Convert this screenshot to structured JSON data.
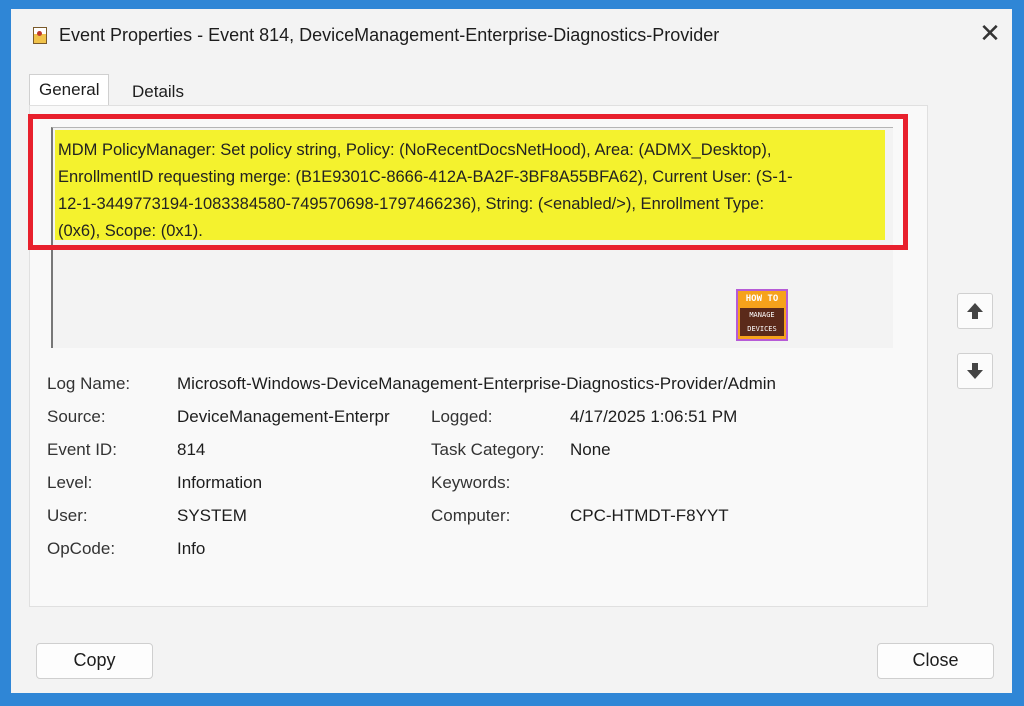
{
  "window": {
    "title": "Event Properties - Event 814, DeviceManagement-Enterprise-Diagnostics-Provider",
    "close_glyph": "✕"
  },
  "tabs": [
    {
      "label": "General"
    },
    {
      "label": "Details"
    }
  ],
  "message": {
    "lines": [
      "MDM PolicyManager: Set policy string, Policy: (NoRecentDocsNetHood), Area: (ADMX_Desktop),",
      "EnrollmentID requesting merge: (B1E9301C-8666-412A-BA2F-3BF8A55BFA62), Current User: (S-1-",
      "12-1-3449773194-1083384580-749570698-1797466236), String: (<enabled/>), Enrollment Type:",
      "(0x6), Scope: (0x1)."
    ],
    "highlight_color": "#f4f22e",
    "annotation_color": "#e8202d"
  },
  "logo": {
    "line1": "HOW TO",
    "line2": "MANAGE",
    "line3": "DEVICES"
  },
  "details": {
    "log_name_label": "Log Name:",
    "log_name": "Microsoft-Windows-DeviceManagement-Enterprise-Diagnostics-Provider/Admin",
    "source_label": "Source:",
    "source": "DeviceManagement-Enterpr",
    "logged_label": "Logged:",
    "logged": "4/17/2025 1:06:51 PM",
    "event_id_label": "Event ID:",
    "event_id": "814",
    "task_category_label": "Task Category:",
    "task_category": "None",
    "level_label": "Level:",
    "level": "Information",
    "keywords_label": "Keywords:",
    "user_label": "User:",
    "user": "SYSTEM",
    "computer_label": "Computer:",
    "computer": "CPC-HTMDT-F8YYT",
    "opcode_label": "OpCode:",
    "opcode": "Info"
  },
  "nav": {
    "up_icon": "arrow-up-icon",
    "down_icon": "arrow-down-icon"
  },
  "buttons": {
    "copy": "Copy",
    "close": "Close"
  }
}
